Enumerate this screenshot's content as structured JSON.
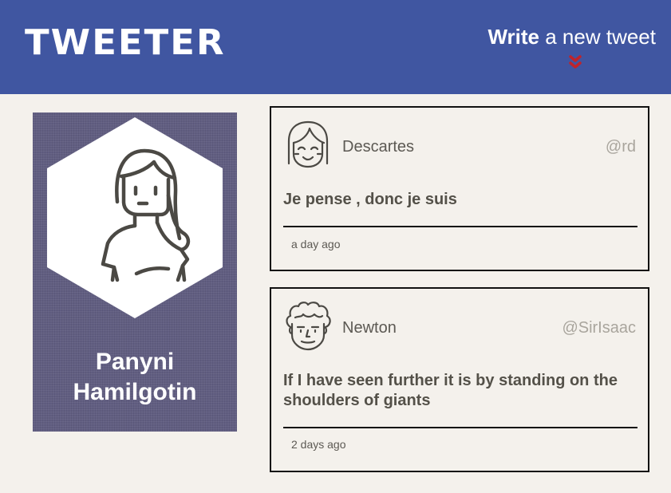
{
  "header": {
    "logo": "TWEETER",
    "compose_bold": "Write",
    "compose_rest": " a new tweet",
    "chevron_icon": "double-chevron-down-icon",
    "accent": "#c0232a",
    "bar_color": "#4056a1"
  },
  "profile": {
    "first_name": "Panyni",
    "last_name": "Hamilgotin",
    "avatar_icon": "woman-avatar-icon",
    "card_color": "#615e81"
  },
  "tweets": [
    {
      "avatar_icon": "girl-avatar-icon",
      "name": "Descartes",
      "handle": "@rd",
      "text": "Je pense , donc je suis",
      "time": "a day ago"
    },
    {
      "avatar_icon": "curly-hair-avatar-icon",
      "name": "Newton",
      "handle": "@SirIsaac",
      "text": "If I have seen further it is by standing on the shoulders of giants",
      "time": "2 days ago"
    }
  ]
}
